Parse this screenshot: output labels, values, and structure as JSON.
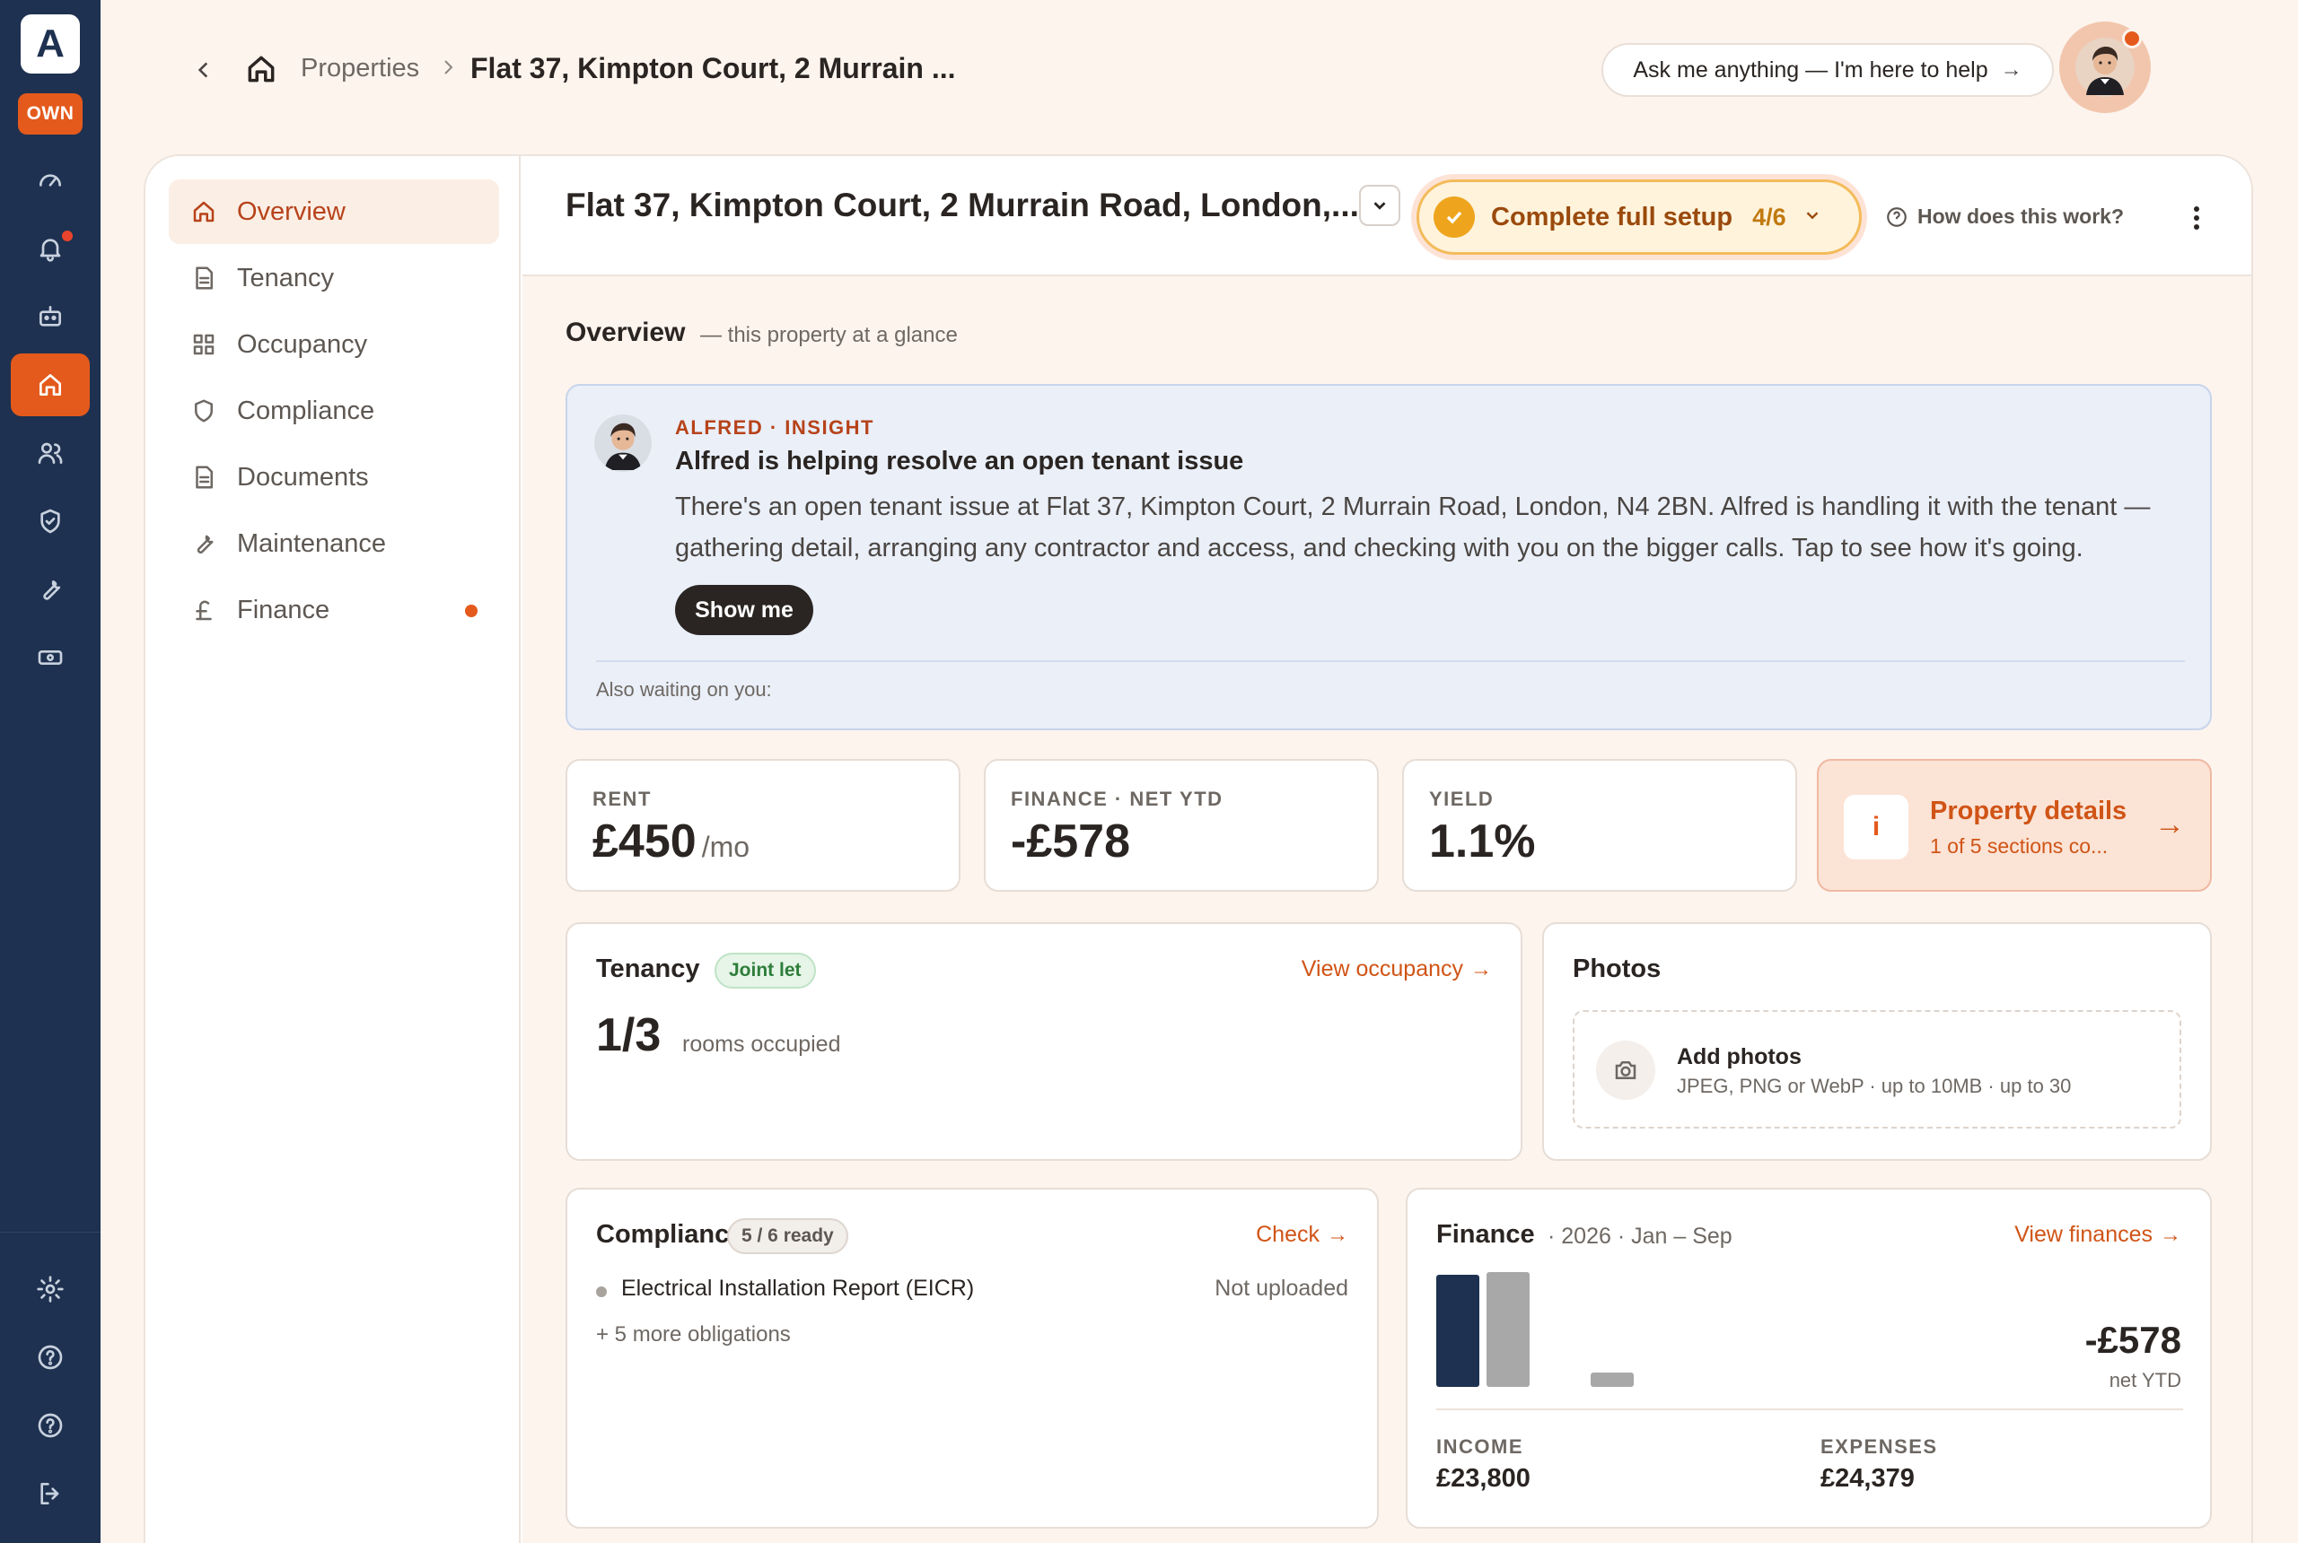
{
  "rail": {
    "logo": "A",
    "badge": "OWN",
    "items": [
      {
        "icon": "dashboard-gauge-icon",
        "active": false
      },
      {
        "icon": "bell-icon",
        "active": false,
        "dot": true
      },
      {
        "icon": "bot-icon",
        "active": false
      },
      {
        "icon": "home-icon",
        "active": true
      },
      {
        "icon": "users-icon",
        "active": false
      },
      {
        "icon": "shield-check-icon",
        "active": false
      },
      {
        "icon": "wrench-icon",
        "active": false
      },
      {
        "icon": "banknote-icon",
        "active": false
      }
    ],
    "bottom": [
      {
        "icon": "settings-gear-icon"
      },
      {
        "icon": "help-circle-icon"
      },
      {
        "icon": "help-circle-icon"
      },
      {
        "icon": "logout-icon"
      }
    ]
  },
  "topbar": {
    "breadcrumb_properties": "Properties",
    "breadcrumb_current": "Flat 37, Kimpton Court, 2 Murrain ...",
    "ask_label": "Ask me anything — I'm here to help",
    "ask_arrow": "→"
  },
  "sidenav": {
    "items": [
      {
        "label": "Overview",
        "icon": "home-icon",
        "active": true
      },
      {
        "label": "Tenancy",
        "icon": "document-icon"
      },
      {
        "label": "Occupancy",
        "icon": "grid-icon"
      },
      {
        "label": "Compliance",
        "icon": "shield-icon"
      },
      {
        "label": "Documents",
        "icon": "document-icon"
      },
      {
        "label": "Maintenance",
        "icon": "wrench-icon"
      },
      {
        "label": "Finance",
        "icon": "pound-icon",
        "dot": true
      }
    ]
  },
  "header": {
    "property_title": "Flat 37, Kimpton Court, 2 Murrain Road, London,...",
    "setup_label": "Complete full setup",
    "setup_count": "4/6",
    "how_link": "How does this work?"
  },
  "overview": {
    "heading": "Overview",
    "subheading": "— this property at a glance"
  },
  "insight": {
    "kicker": "ALFRED · INSIGHT",
    "title": "Alfred is helping resolve an open tenant issue",
    "body": "There's an open tenant issue at Flat 37, Kimpton Court, 2 Murrain Road, London, N4 2BN. Alfred is handling it with the tenant — gathering detail, arranging any contractor and access, and checking with you on the bigger calls. Tap to see how it's going.",
    "button": "Show me",
    "waiting": "Also waiting on you:"
  },
  "stats": {
    "rent_label": "RENT",
    "rent_value": "£450",
    "rent_unit": "/mo",
    "finance_label": "FINANCE · NET YTD",
    "finance_value": "-£578",
    "yield_label": "YIELD",
    "yield_value": "1.1%",
    "details_icon": "i",
    "details_title": "Property details",
    "details_sub": "1 of 5 sections co...",
    "details_arrow": "→"
  },
  "tenancy": {
    "title": "Tenancy",
    "badge": "Joint let",
    "link": "View occupancy",
    "link_arrow": "→",
    "occupied": "1/3",
    "occupied_label": "rooms occupied"
  },
  "photos": {
    "title": "Photos",
    "add_title": "Add photos",
    "add_sub": "JPEG, PNG or WebP · up to 10MB · up to 30"
  },
  "compliance": {
    "title": "Compliance",
    "badge": "5 / 6 ready",
    "link": "Check",
    "link_arrow": "→",
    "obligation_name": "Electrical Installation Report (EICR)",
    "obligation_status": "Not uploaded",
    "more": "+ 5 more obligations"
  },
  "finance": {
    "title": "Finance",
    "period": "· 2026 · Jan – Sep",
    "link": "View finances",
    "link_arrow": "→",
    "net_value": "-£578",
    "net_label": "net YTD",
    "income_label": "INCOME",
    "income_value": "£23,800",
    "expenses_label": "EXPENSES",
    "expenses_value": "£24,379"
  },
  "chart_data": {
    "type": "bar",
    "categories": [
      "Income",
      "Expenses",
      "Net"
    ],
    "values": [
      23800,
      24379,
      578
    ],
    "colors": [
      "#1e3150",
      "#a8a8a8",
      "#a8a8a8"
    ]
  },
  "colors": {
    "accent": "#e45a1c",
    "rail": "#1e3150",
    "link": "#d05416"
  }
}
